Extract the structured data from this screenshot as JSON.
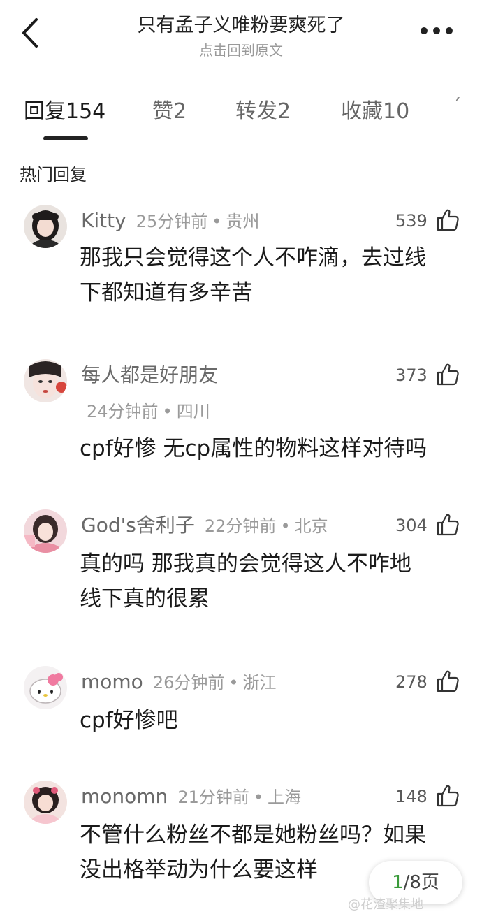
{
  "header": {
    "title": "只有孟子义唯粉要爽死了",
    "subtitle": "点击回到原文"
  },
  "tabs": [
    {
      "label": "回复",
      "count": "154"
    },
    {
      "label": "赞",
      "count": "2"
    },
    {
      "label": "转发",
      "count": "2"
    },
    {
      "label": "收藏",
      "count": "10"
    }
  ],
  "section_label": "热门回复",
  "comments": [
    {
      "username": "Kitty",
      "time": "25分钟前",
      "separator": "•",
      "location": "贵州",
      "likes": "539",
      "text_lines": [
        "那我只会觉得这个人不咋滴，去过线",
        "下都知道有多辛苦"
      ]
    },
    {
      "username": "每人都是好朋友",
      "time": "24分钟前",
      "separator": "•",
      "location": "四川",
      "likes": "373",
      "text_lines": [
        "cpf好惨 无cp属性的物料这样对待吗"
      ]
    },
    {
      "username": "God's舍利子",
      "time": "22分钟前",
      "separator": "•",
      "location": "北京",
      "likes": "304",
      "text_lines": [
        "真的吗 那我真的会觉得这人不咋地",
        "线下真的很累"
      ]
    },
    {
      "username": "momo",
      "time": "26分钟前",
      "separator": "•",
      "location": "浙江",
      "likes": "278",
      "text_lines": [
        "cpf好惨吧"
      ]
    },
    {
      "username": "monomn",
      "time": "21分钟前",
      "separator": "•",
      "location": "上海",
      "likes": "148",
      "text_lines": [
        "不管什么粉丝不都是她粉丝吗？如果",
        "没出格举动为什么要这样"
      ]
    }
  ],
  "pager": {
    "current": "1",
    "total": "/8页"
  },
  "watermark": "@花渣聚集地",
  "icons": {
    "back": "chevron-left-icon",
    "more": "more-dots-icon",
    "like": "thumbs-up-icon"
  }
}
